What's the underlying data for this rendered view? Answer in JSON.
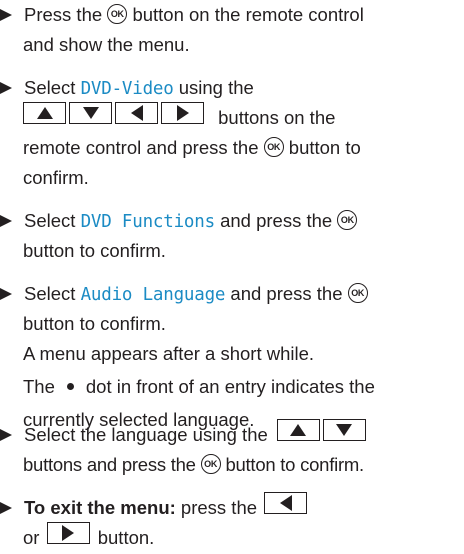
{
  "instructions": {
    "step1": {
      "line1_pre": "Press the",
      "line1_post": "button on the remote control",
      "line2": "and show the menu."
    },
    "step2": {
      "select": "Select",
      "highlight": "DVD-Video",
      "using_the": "using the",
      "buttons_on_the": "buttons on the",
      "line3_pre": "remote control and press the",
      "line3_post": "button to",
      "line4": "confirm."
    },
    "step3": {
      "select": "Select",
      "highlight": "DVD Functions",
      "line1_post": "and press the",
      "line2": "button to confirm."
    },
    "step4": {
      "select": "Select",
      "highlight": "Audio Language",
      "line1_post": "and press the",
      "line2": "button to confirm.",
      "line3": "A menu appears after a short while.",
      "line4_pre": "The",
      "line4_post": "dot in front of an entry indicates the",
      "line5": "currently selected language."
    },
    "step5": {
      "line1_pre": "Select the language using the",
      "line2_pre": "buttons and press the",
      "line2_post": "button to confirm."
    },
    "step6": {
      "bold": "To exit the menu:",
      "line1_post": "press the",
      "or": "or",
      "button": "button."
    }
  },
  "ok_label": "OK",
  "accent_color": "#1b8bc4"
}
